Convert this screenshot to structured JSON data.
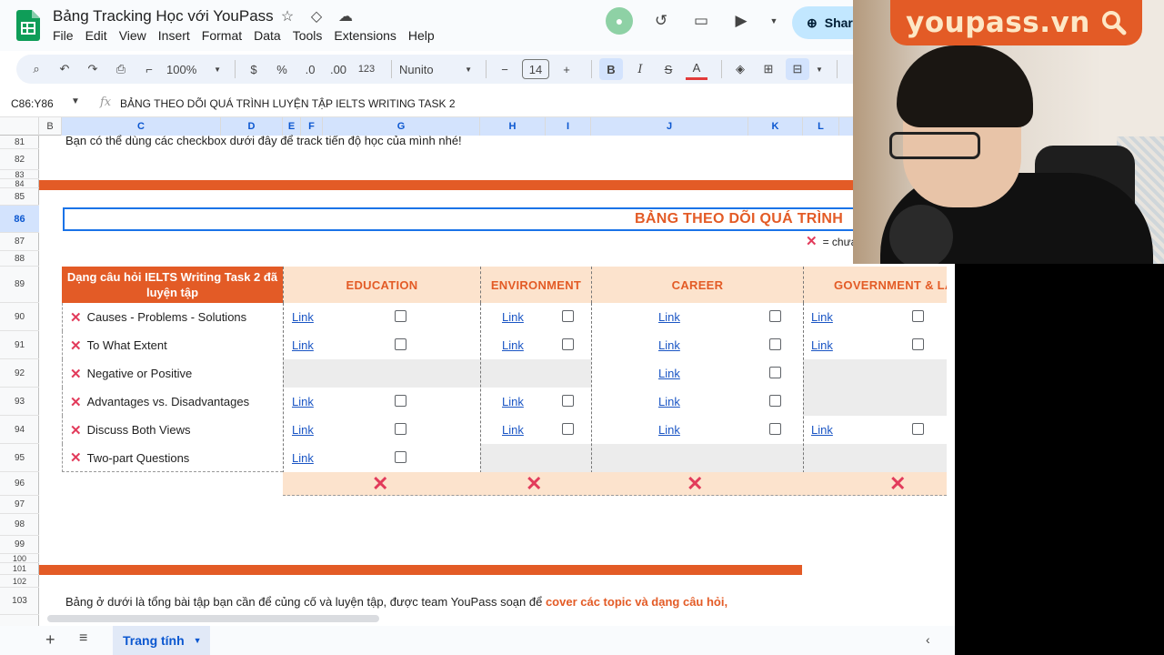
{
  "app": {
    "doc_title": "Bảng Tracking Học với YouPass",
    "menu": [
      "File",
      "Edit",
      "View",
      "Insert",
      "Format",
      "Data",
      "Tools",
      "Extensions",
      "Help"
    ],
    "share_label": "Shar"
  },
  "toolbar": {
    "zoom": "100%",
    "currency": "$",
    "percent": "%",
    "dec_less": ".0",
    "dec_more": ".00",
    "number_format": "123",
    "font": "Nunito",
    "font_size": "14",
    "bold": "B",
    "italic": "I",
    "strike": "S",
    "text_color": "A"
  },
  "formula_bar": {
    "name_box": "C86:Y86",
    "fx": "fx",
    "content": "BẢNG THEO DÕI QUÁ TRÌNH LUYỆN TẬP IELTS WRITING TASK 2"
  },
  "columns": [
    "B",
    "C",
    "D",
    "E",
    "F",
    "G",
    "H",
    "I",
    "J",
    "K",
    "L"
  ],
  "rows": [
    "81",
    "82",
    "83",
    "84",
    "85",
    "86",
    "87",
    "88",
    "89",
    "90",
    "91",
    "92",
    "93",
    "94",
    "95",
    "96",
    "97",
    "98",
    "99",
    "100",
    "101",
    "102",
    "103"
  ],
  "sheet": {
    "note_text": "Bạn có thể dùng các checkbox dưới đây để track tiến độ học của mình nhé!",
    "table_title": "BẢNG THEO DÕI QUÁ TRÌNH",
    "legend_text": "= chưa",
    "header_left": "Dạng câu hỏi IELTS Writing Task 2 đã luyện tập",
    "topics": [
      "EDUCATION",
      "ENVIRONMENT",
      "CAREER",
      "GOVERNMENT & LA"
    ],
    "question_types": [
      "Causes - Problems - Solutions",
      "To What Extent",
      "Negative or Positive",
      "Advantages vs. Disadvantages",
      "Discuss Both Views",
      "Two-part Questions"
    ],
    "link_label": "Link",
    "bottom_text": "Bảng ở dưới là tổng bài tập bạn cần để củng cố và luyện tập, được team YouPass soạn để ",
    "bottom_highlight": "cover các topic và dạng câu hỏi,"
  },
  "sheet_tabs": {
    "active": "Trang tính"
  },
  "overlay": {
    "brand": "youpass.vn"
  },
  "colors": {
    "accent_orange": "#e35b26",
    "header_peach": "#fce3cd",
    "cross_red": "#e23b5b",
    "link_blue": "#1a55c4"
  }
}
